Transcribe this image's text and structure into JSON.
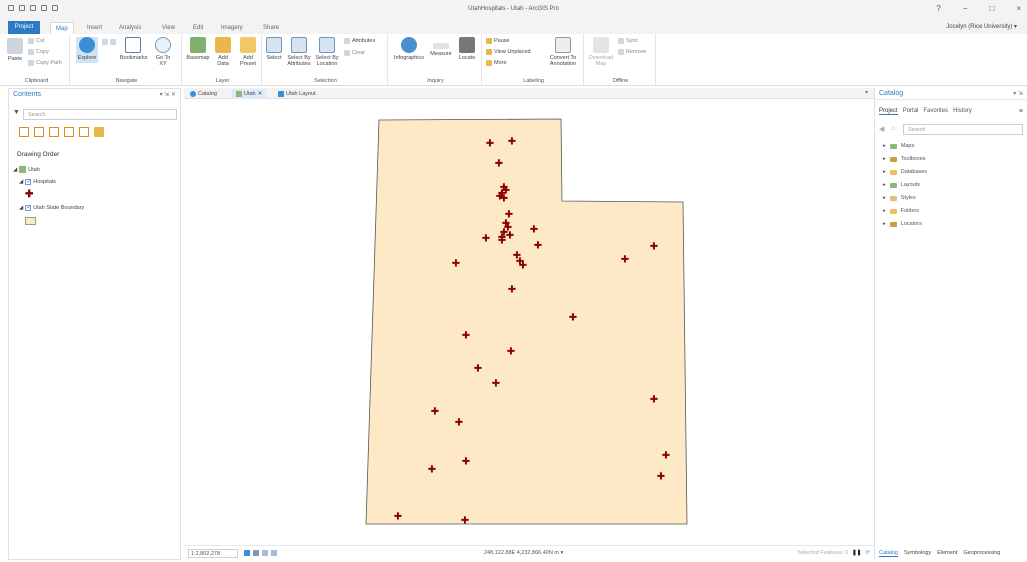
{
  "window": {
    "title": "UtahHospitals - Utah - ArcGIS Pro",
    "controls": [
      "?",
      "−",
      "□",
      "×"
    ]
  },
  "ribbon": {
    "tabs": [
      "Project",
      "Map",
      "Insert",
      "Analysis",
      "View",
      "Edit",
      "Imagery",
      "Share"
    ],
    "active_tab": "Map",
    "user": "Jocelyn (Rice University) ▾",
    "groups": {
      "clipboard": {
        "label": "Clipboard",
        "paste": "Paste",
        "cut": "Cut",
        "copy": "Copy",
        "copy_path": "Copy Path"
      },
      "navigate": {
        "label": "Navigate",
        "explore": "Explore",
        "bookmarks": "Bookmarks",
        "go_to_xy": "Go To XY"
      },
      "layer": {
        "label": "Layer",
        "basemap": "Basemap",
        "add_data": "Add Data",
        "add_preset": "Add Preset"
      },
      "selection": {
        "label": "Selection",
        "select": "Select",
        "by_attributes": "Select By Attributes",
        "by_location": "Select By Location",
        "attributes": "Attributes",
        "clear": "Clear"
      },
      "inquiry": {
        "label": "Inquiry",
        "infographics": "Infographics",
        "measure": "Measure",
        "locate": "Locate"
      },
      "labeling": {
        "label": "Labeling",
        "pause": "Pause",
        "view_unplaced": "View Unplaced",
        "more": "More",
        "convert": "Convert To Annotation"
      },
      "offline": {
        "label": "Offline",
        "download_map": "Download Map",
        "sync": "Sync",
        "remove": "Remove"
      }
    }
  },
  "contents": {
    "title": "Contents",
    "search_placeholder": "Search",
    "drawing_order": "Drawing Order",
    "layers": [
      {
        "name": "Utah"
      },
      {
        "name": "Hospitals"
      },
      {
        "name": "Utah State Boundary"
      }
    ]
  },
  "view_tabs": [
    "Catalog",
    "Utah",
    "Utah Layout"
  ],
  "map": {
    "fill_color": "#fde9c5",
    "outline_color": "#555555",
    "hospital_color": "#8b0000"
  },
  "status": {
    "scale": "1:2,802,278",
    "coordinates": "248,122.88E 4,232,866.40N m",
    "selected": "Selected Features: 0"
  },
  "catalog": {
    "title": "Catalog",
    "subtabs": [
      "Project",
      "Portal",
      "Favorites",
      "History"
    ],
    "search_placeholder": "Search",
    "items": [
      "Maps",
      "Toolboxes",
      "Databases",
      "Layouts",
      "Styles",
      "Folders",
      "Locators"
    ],
    "bottom_tabs": [
      "Catalog",
      "Symbology",
      "Element",
      "Geoprocessing"
    ]
  }
}
